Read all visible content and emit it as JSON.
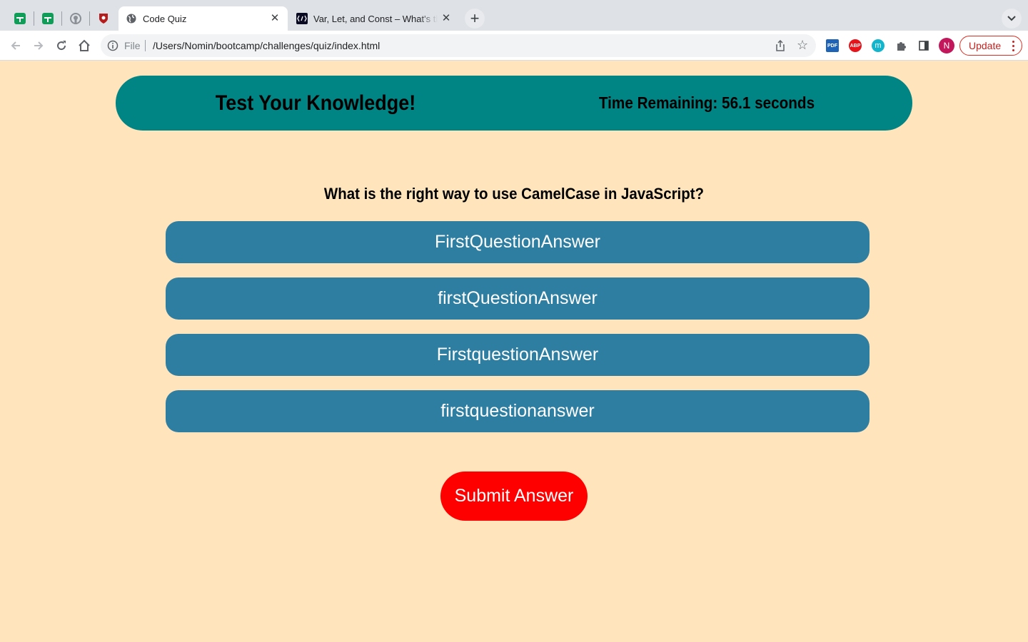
{
  "browser": {
    "pinned_tabs": [
      {
        "icon": "google-sheets-icon",
        "color": "#0f9d58"
      },
      {
        "icon": "google-sheets-icon",
        "color": "#0f9d58"
      },
      {
        "icon": "github-icon",
        "color": "#8a8f96"
      },
      {
        "icon": "shield-icon",
        "color": "#b71c1c"
      }
    ],
    "tabs": [
      {
        "title": "Code Quiz",
        "icon": "globe-icon",
        "active": true
      },
      {
        "title": "Var, Let, and Const – What's the Difference?",
        "icon": "freecodecamp-icon",
        "active": false
      }
    ],
    "address": {
      "scheme": "File",
      "url": "/Users/Nomin/bootcamp/challenges/quiz/index.html"
    },
    "extensions": [
      {
        "name": "pdf-extension-icon",
        "label": "PDF",
        "color": "#1e63b5"
      },
      {
        "name": "adblock-plus-icon",
        "label": "ABP",
        "color": "#e8141c"
      },
      {
        "name": "m-extension-icon",
        "label": "m",
        "color": "#12b5cb"
      }
    ],
    "profile_initial": "N",
    "update_label": "Update"
  },
  "quiz": {
    "title": "Test Your Knowledge!",
    "timer_text": "Time Remaining: 56.1 seconds",
    "question": "What is the right way to use CamelCase in JavaScript?",
    "answers": [
      "FirstQuestionAnswer",
      "firstQuestionAnswer",
      "FirstquestionAnswer",
      "firstquestionanswer"
    ],
    "submit_label": "Submit Answer"
  },
  "colors": {
    "page_background": "#ffe4bc",
    "header_background": "#008484",
    "answer_background": "#2e7ea2",
    "submit_background": "#ff0000"
  }
}
